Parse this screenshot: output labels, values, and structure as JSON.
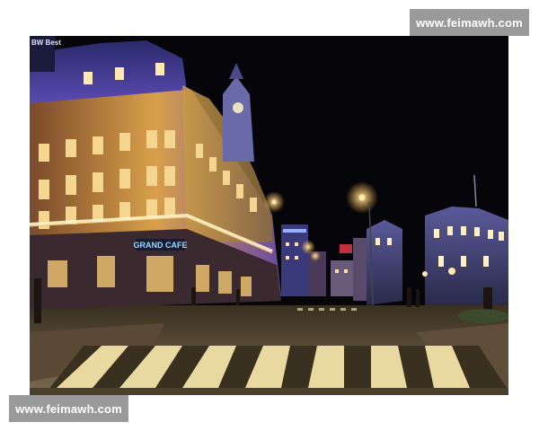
{
  "watermark": {
    "top_text": "www.feimawh.com",
    "bottom_text": "www.feimawh.com"
  },
  "photo": {
    "scene": "night-street",
    "signs": {
      "hotel_name": "GRAND CAFE",
      "corner_sign": "BW Best"
    },
    "colors": {
      "sky": "#05050a",
      "facade_warm": "#d9a24a",
      "facade_purple": "#4b3a8a",
      "street_light": "#ffcf6a",
      "crosswalk": "#e8d9a0",
      "pavement": "#6b5a45"
    }
  }
}
